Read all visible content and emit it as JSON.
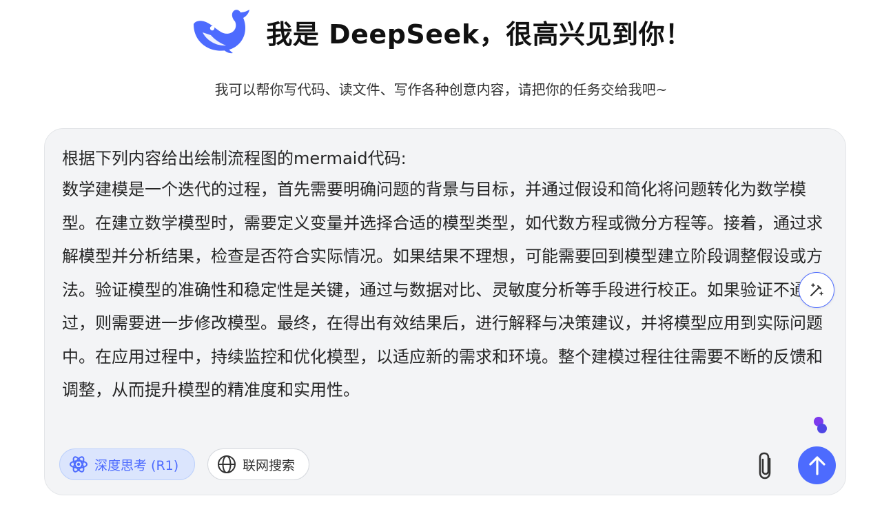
{
  "header": {
    "logo_icon": "deepseek-whale-icon",
    "title": "我是 DeepSeek，很高兴见到你！",
    "subtitle": "我可以帮你写代码、读文件、写作各种创意内容，请把你的任务交给我吧~"
  },
  "composer": {
    "prompt_line1": "根据下列内容给出绘制流程图的mermaid代码:",
    "prompt_body": "数学建模是一个迭代的过程，首先需要明确问题的背景与目标，并通过假设和简化将问题转化为数学模型。在建立数学模型时，需要定义变量并选择合适的模型类型，如代数方程或微分方程等。接着，通过求解模型并分析结果，检查是否符合实际情况。如果结果不理想，可能需要回到模型建立阶段调整假设或方法。验证模型的准确性和稳定性是关键，通过与数据对比、灵敏度分析等手段进行校正。如果验证不通过，则需要进一步修改模型。最终，在得出有效结果后，进行解释与决策建议，并将模型应用到实际问题中。在应用过程中，持续监控和优化模型，以适应新的需求和环境。整个建模过程往往需要不断的反馈和调整，从而提升模型的精准度和实用性。",
    "edit_icon": "magic-pen-icon",
    "deep_think_label": "深度思考 (R1)",
    "deep_think_icon": "atom-icon",
    "deep_think_active": true,
    "web_search_label": "联网搜索",
    "web_search_icon": "globe-icon",
    "attach_icon": "paperclip-icon",
    "send_icon": "arrow-up-icon"
  },
  "colors": {
    "accent": "#4d6bfe",
    "composer_bg": "#f3f4f6",
    "chip_active_bg": "#dbe5fd"
  }
}
